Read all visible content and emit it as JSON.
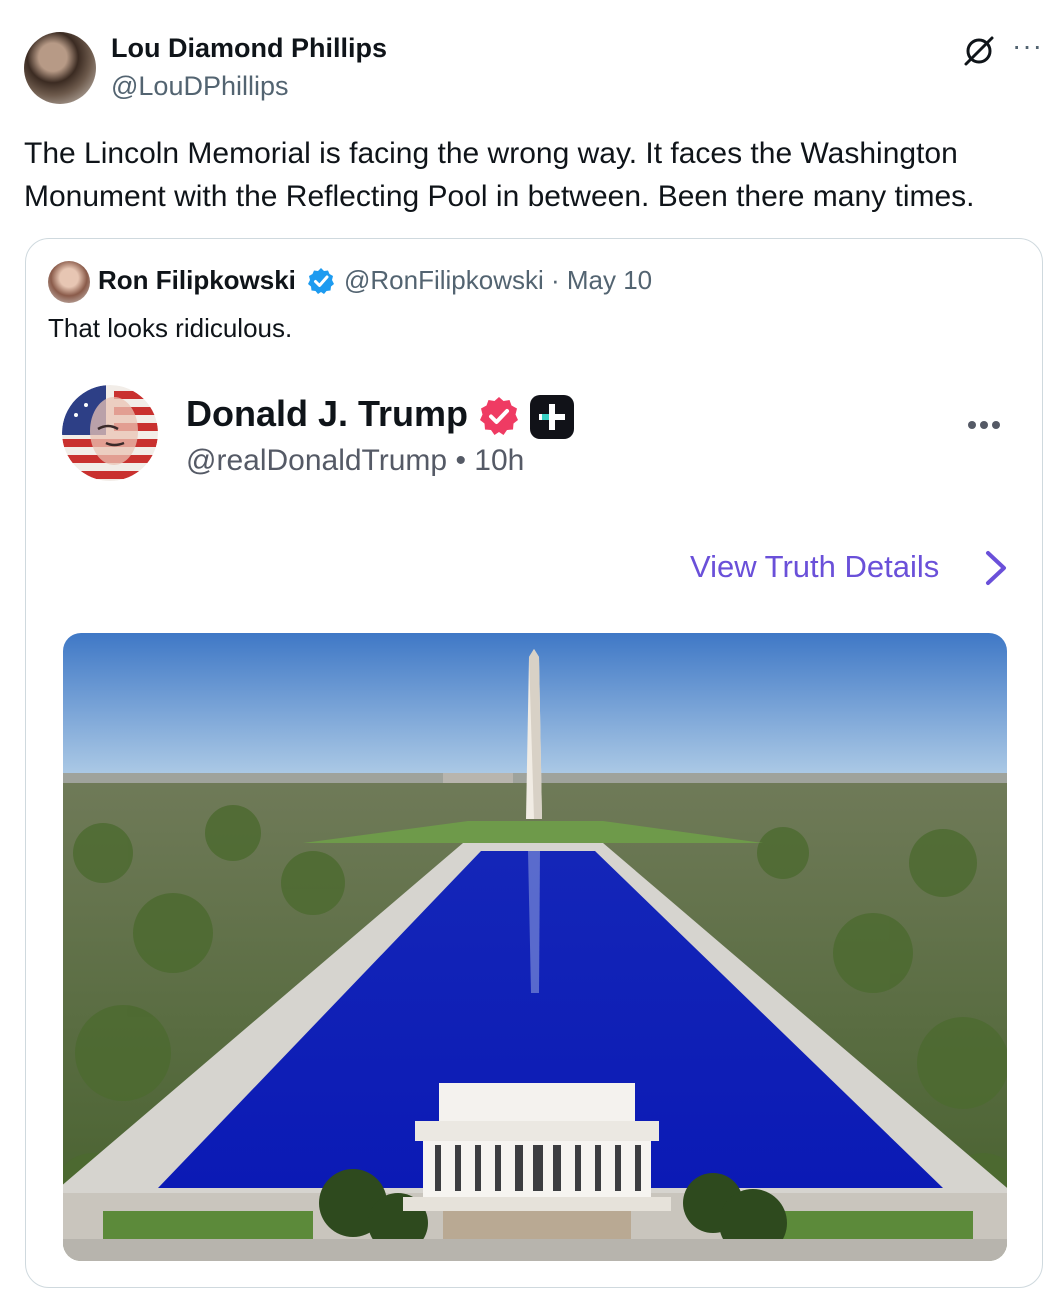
{
  "author": {
    "name": "Lou Diamond Phillips",
    "handle": "@LouDPhillips"
  },
  "icons": {
    "grok": "grok-icon",
    "more": "more-icon",
    "verified": "verified-badge-icon",
    "chevron": "chevron-right-icon",
    "plus": "truth-plus-icon"
  },
  "tweet": {
    "text": "The Lincoln Memorial is facing the wrong way. It faces the Washington Monument with the Reflecting Pool in between. Been there many times."
  },
  "quoted": {
    "name": "Ron Filipkowski",
    "handle_date": "@RonFilipkowski · May 10",
    "text": "That looks ridiculous.",
    "embedded_post": {
      "name": "Donald J. Trump",
      "handle_time": "@realDonaldTrump • 10h",
      "details_link": "View Truth Details"
    }
  },
  "colors": {
    "link": "#6a50d9",
    "verified_blue": "#1d9bf0",
    "verified_pink": "#ef3b63",
    "border": "#cfd9de",
    "secondary_text": "#536471"
  },
  "more_dots": "···"
}
